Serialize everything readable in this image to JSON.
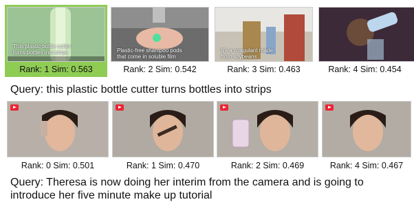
{
  "row1": {
    "items": [
      {
        "caption": "Rank: 1 Sim: 0.563",
        "overlay": "This plastic bottle cutter\nturns bottles into strips",
        "highlight": true
      },
      {
        "caption": "Rank: 2 Sim: 0.542",
        "overlay": "Plastic-free shampoo pods\nthat come in soluble film",
        "highlight": false
      },
      {
        "caption": "Rank: 3 Sim: 0.463",
        "overlay": "It's a coagulant made\nfrom soybeans",
        "highlight": false
      },
      {
        "caption": "Rank: 4 Sim: 0.454",
        "overlay": "",
        "highlight": false
      }
    ],
    "query_label": "Query",
    "query_text": ": this plastic bottle cutter turns bottles into strips"
  },
  "row2": {
    "items": [
      {
        "caption": "Rank: 0 Sim: 0.501"
      },
      {
        "caption": "Rank: 1 Sim: 0.470"
      },
      {
        "caption": "Rank: 2 Sim: 0.469"
      },
      {
        "caption": "Rank: 4 Sim: 0.467"
      }
    ],
    "query_label": "Query",
    "query_text": ": Theresa is now doing her interim from the camera and is going to introduce her five minute make up tutorial"
  },
  "colors": {
    "highlight": "#8fcc54",
    "youtube": "#e22233"
  }
}
